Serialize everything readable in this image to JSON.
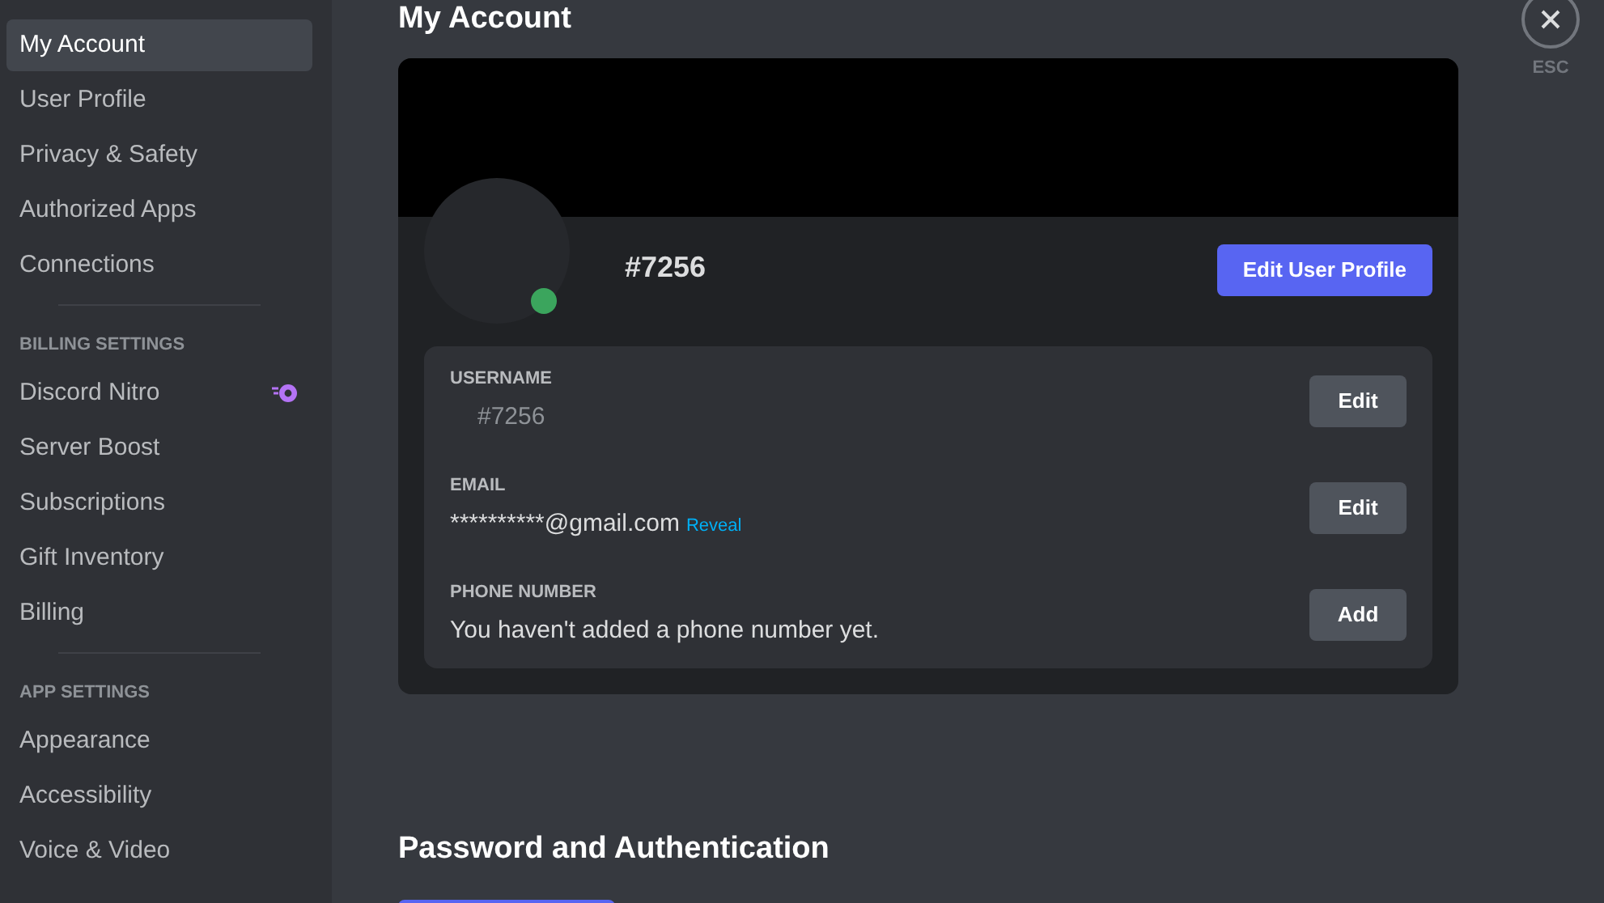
{
  "sidebar": {
    "sections": [
      {
        "items": [
          {
            "label": "My Account",
            "selected": true
          },
          {
            "label": "User Profile",
            "selected": false
          },
          {
            "label": "Privacy & Safety",
            "selected": false
          },
          {
            "label": "Authorized Apps",
            "selected": false
          },
          {
            "label": "Connections",
            "selected": false
          }
        ]
      },
      {
        "heading": "BILLING SETTINGS",
        "items": [
          {
            "label": "Discord Nitro",
            "selected": false,
            "badge": true
          },
          {
            "label": "Server Boost",
            "selected": false
          },
          {
            "label": "Subscriptions",
            "selected": false
          },
          {
            "label": "Gift Inventory",
            "selected": false
          },
          {
            "label": "Billing",
            "selected": false
          }
        ]
      },
      {
        "heading": "APP SETTINGS",
        "items": [
          {
            "label": "Appearance",
            "selected": false
          },
          {
            "label": "Accessibility",
            "selected": false
          },
          {
            "label": "Voice & Video",
            "selected": false
          }
        ]
      }
    ]
  },
  "page": {
    "title": "My Account",
    "profile": {
      "tag": "#7256",
      "online": true,
      "edit_button": "Edit User Profile"
    },
    "fields": [
      {
        "label": "USERNAME",
        "value": "#7256",
        "button": "Edit",
        "kind": "muted"
      },
      {
        "label": "EMAIL",
        "value": "**********@gmail.com",
        "link": "Reveal",
        "button": "Edit",
        "kind": "plain"
      },
      {
        "label": "PHONE NUMBER",
        "value": "You haven't added a phone number yet.",
        "button": "Add",
        "kind": "plain"
      }
    ],
    "section_title": "Password and Authentication"
  },
  "close": {
    "label": "ESC"
  }
}
